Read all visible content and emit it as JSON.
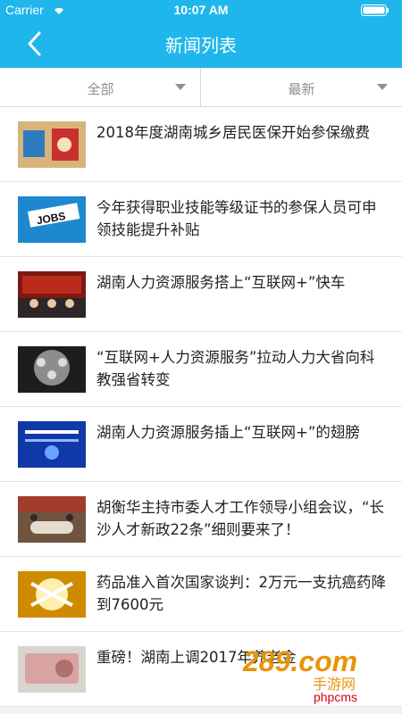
{
  "status_bar": {
    "carrier": "Carrier",
    "time": "10:07 AM"
  },
  "nav": {
    "title": "新闻列表"
  },
  "filters": {
    "category": "全部",
    "sort": "最新"
  },
  "news": [
    {
      "title": "2018年度湖南城乡居民医保开始参保缴费",
      "thumb_icon": "medical-insurance-thumb"
    },
    {
      "title": "今年获得职业技能等级证书的参保人员可申领技能提升补贴",
      "thumb_icon": "jobs-thumb"
    },
    {
      "title": "湖南人力资源服务搭上“互联网+”快车",
      "thumb_icon": "conference-thumb"
    },
    {
      "title": "“互联网+人力资源服务”拉动人力大省向科教强省转变",
      "thumb_icon": "network-thumb"
    },
    {
      "title": "湖南人力资源服务插上“互联网+”的翅膀",
      "thumb_icon": "blue-banner-thumb"
    },
    {
      "title": "胡衡华主持市委人才工作领导小组会议，“长沙人才新政22条”细则要来了！",
      "thumb_icon": "meeting-thumb"
    },
    {
      "title": "药品准入首次国家谈判：2万元一支抗癌药降到7600元",
      "thumb_icon": "medicine-thumb"
    },
    {
      "title": "重磅！湖南上调2017年养老金",
      "thumb_icon": "money-thumb"
    }
  ],
  "watermark": {
    "logo": "289.com",
    "tag": "手游网",
    "site": "phpcms"
  },
  "colors": {
    "primary": "#1fb6ec",
    "watermark": "#e8940a"
  }
}
